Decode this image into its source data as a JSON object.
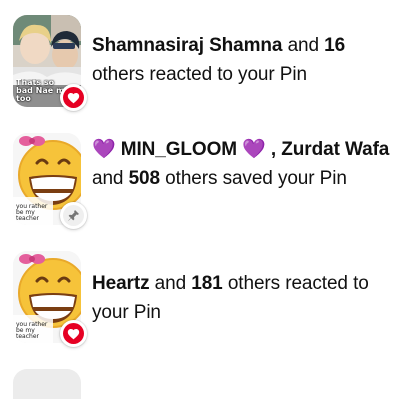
{
  "notifications": [
    {
      "pre": "",
      "name1": "Shamnasiraj Shamna",
      "and": " and ",
      "count": "16",
      "rest": " others reacted to your Pin",
      "thumb_caption": "Thats so bad Nae me too",
      "badge_icon": "heart-icon"
    },
    {
      "pre": "💜 ",
      "name1": "MIN_GLOOM",
      "mid": " 💜 , ",
      "name2": "Zurdat Wafa",
      "and": " and ",
      "count": "508",
      "rest": " others saved your Pin",
      "thumb_caption": "you rather be my teacher",
      "badge_icon": "pin-icon"
    },
    {
      "name1": "Heartz",
      "and": " and ",
      "count": "181",
      "rest": " others reacted to your Pin",
      "thumb_caption": "you rather be my teacher",
      "badge_icon": "heart-icon"
    }
  ],
  "colors": {
    "heart": "#e60023",
    "text": "#111111",
    "gloom_heart": "#3b2a4a"
  }
}
